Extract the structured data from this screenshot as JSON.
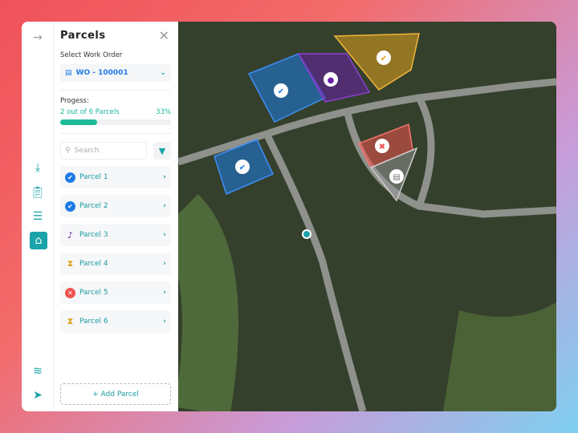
{
  "panel": {
    "title": "Parcels",
    "work_order_label": "Select Work Order",
    "work_order": "WO - 100001",
    "progress_label": "Progess:",
    "progress_text": "2 out of 6 Parcels",
    "progress_percent": "33%",
    "progress_value": 33,
    "search_placeholder": "Search",
    "add_parcel": "+ Add Parcel",
    "parcels": [
      {
        "label": "Parcel 1",
        "status": "completed",
        "color": "#1e7be6"
      },
      {
        "label": "Parcel 2",
        "status": "completed",
        "color": "#1e7be6"
      },
      {
        "label": "Parcel 3",
        "status": "notification",
        "color": "#6a1fa8"
      },
      {
        "label": "Parcel 4",
        "status": "pending",
        "color": "#e2a21f"
      },
      {
        "label": "Parcel 5",
        "status": "rejected",
        "color": "#f0524f"
      },
      {
        "label": "Parcel 6",
        "status": "pending",
        "color": "#e2a21f"
      }
    ]
  },
  "rail": {
    "icons": [
      "arrow-right-icon",
      "download-icon",
      "clipboard-icon",
      "list-icon",
      "home-icon",
      "layers-icon",
      "navigation-icon"
    ]
  }
}
